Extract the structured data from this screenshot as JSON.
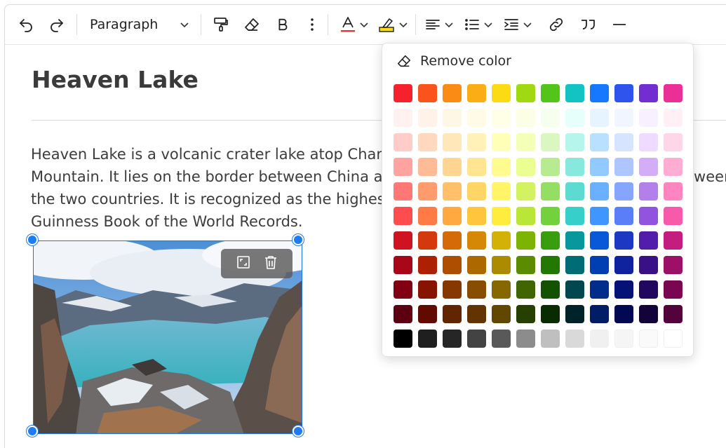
{
  "toolbar": {
    "block_style": "Paragraph"
  },
  "document": {
    "title": "Heaven Lake",
    "paragraph": "Heaven Lake is a volcanic crater lake atop Changbai Mountain, known in Korea as Paektu Mountain. It lies on the border between China and North Korea and the lake is divided between the two countries. It is recognized as the highest volcanic crater lake in the world by the Guinness Book of the World Records."
  },
  "palette": {
    "remove_label": "Remove color",
    "colors": [
      [
        "#f5222d",
        "#fa541c",
        "#fa8c16",
        "#faad14",
        "#fadb14",
        "#a0d911",
        "#52c41a",
        "#13c2c2",
        "#1677ff",
        "#2f54eb",
        "#722ed1",
        "#eb2f96"
      ],
      [
        "#fff1f0",
        "#fff2e8",
        "#fff7e6",
        "#fffbe6",
        "#feffe6",
        "#fcffe6",
        "#f6ffed",
        "#e6fffb",
        "#e6f4ff",
        "#f0f5ff",
        "#f9f0ff",
        "#fff0f6"
      ],
      [
        "#ffccc7",
        "#ffd8bf",
        "#ffe7ba",
        "#fff1b8",
        "#ffffb8",
        "#f4ffb8",
        "#d9f7be",
        "#b5f5ec",
        "#bae0ff",
        "#d6e4ff",
        "#efdbff",
        "#ffd6e7"
      ],
      [
        "#ffa39e",
        "#ffbb96",
        "#ffd591",
        "#ffe58f",
        "#fffb8f",
        "#eaff8f",
        "#b7eb8f",
        "#87e8de",
        "#91caff",
        "#adc6ff",
        "#d3adf7",
        "#ffadd2"
      ],
      [
        "#ff7875",
        "#ff9c6e",
        "#ffc069",
        "#ffd666",
        "#fff566",
        "#d3f261",
        "#95de64",
        "#5cdbd3",
        "#69b1ff",
        "#85a5ff",
        "#b37feb",
        "#ff85c0"
      ],
      [
        "#ff4d4f",
        "#ff7a45",
        "#ffa940",
        "#ffc53d",
        "#ffec3d",
        "#bae637",
        "#73d13d",
        "#36cfc9",
        "#4096ff",
        "#597ef7",
        "#9254de",
        "#f759ab"
      ],
      [
        "#cf1322",
        "#d4380d",
        "#d46b08",
        "#d48806",
        "#d4b106",
        "#7cb305",
        "#389e0d",
        "#08979c",
        "#0958d9",
        "#1d39c4",
        "#531dab",
        "#c41d7f"
      ],
      [
        "#a8071a",
        "#ad2102",
        "#ad4e00",
        "#ad6800",
        "#ad8b00",
        "#5b8c00",
        "#237804",
        "#006d75",
        "#003eb3",
        "#10239e",
        "#391085",
        "#9e1068"
      ],
      [
        "#820014",
        "#871400",
        "#873800",
        "#874d00",
        "#876800",
        "#3f6600",
        "#135200",
        "#00474f",
        "#002c8c",
        "#061178",
        "#22075e",
        "#780650"
      ],
      [
        "#5c0011",
        "#610b00",
        "#612500",
        "#613400",
        "#614700",
        "#254000",
        "#092b00",
        "#002329",
        "#001d66",
        "#030852",
        "#120338",
        "#520339"
      ],
      [
        "#000000",
        "#1f1f1f",
        "#262626",
        "#434343",
        "#595959",
        "#8c8c8c",
        "#bfbfbf",
        "#d9d9d9",
        "#f0f0f0",
        "#f5f5f5",
        "#fafafa",
        "#ffffff"
      ]
    ]
  },
  "icons": [
    "undo-icon",
    "redo-icon",
    "chevron-down-icon",
    "format-painter-icon",
    "eraser-icon",
    "bold-icon",
    "more-vertical-icon",
    "font-color-icon",
    "highlight-icon",
    "align-left-icon",
    "bulleted-list-icon",
    "indent-icon",
    "link-icon",
    "quote-icon",
    "horizontal-rule-icon",
    "fullscreen-icon",
    "trash-icon"
  ],
  "accent": {
    "font_color_underline": "#e53935",
    "highlight_fill": "#fadb14",
    "selection": "#1f7cf0"
  }
}
